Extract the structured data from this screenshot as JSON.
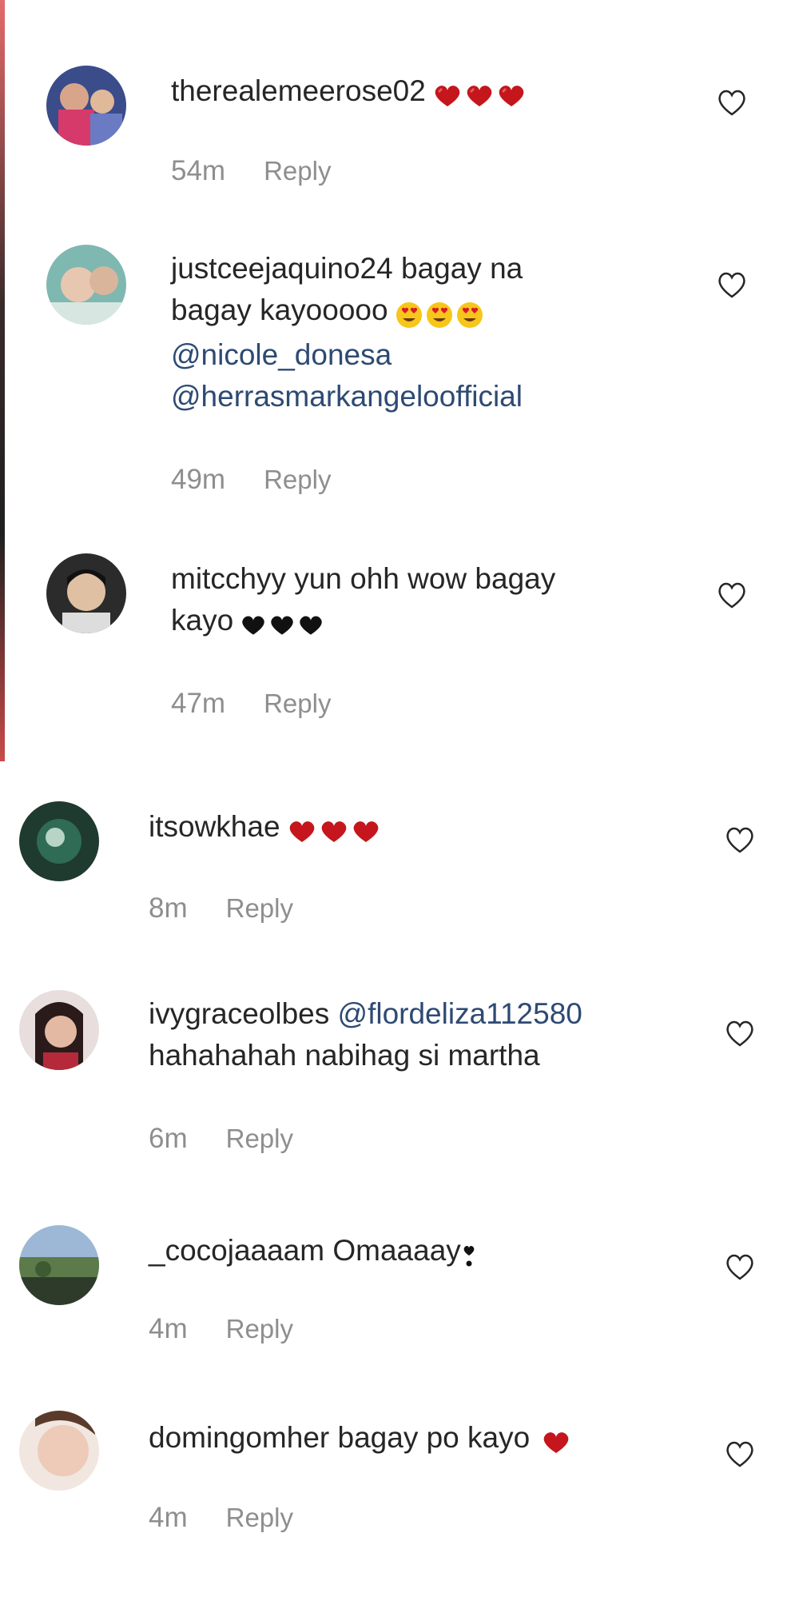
{
  "comments": [
    {
      "username": "therealemeerose02",
      "lines": [
        ""
      ],
      "mentions": [],
      "emoji": {
        "kind": "red-heart-cluster",
        "count": 3
      },
      "time": "54m",
      "reply": "Reply"
    },
    {
      "username": "justceejaquino24",
      "lines": [
        "bagay na",
        "bagay kayooooo"
      ],
      "mentions": [
        "@nicole_donesa",
        "@herrasmarkangeloofficial"
      ],
      "emoji": {
        "kind": "heart-eyes-face",
        "count": 3
      },
      "time": "49m",
      "reply": "Reply"
    },
    {
      "username": "mitcchyy",
      "lines": [
        "yun ohh wow bagay",
        "kayo"
      ],
      "mentions": [],
      "emoji": {
        "kind": "black-heart",
        "count": 3
      },
      "time": "47m",
      "reply": "Reply"
    },
    {
      "username": "itsowkhae",
      "lines": [
        ""
      ],
      "mentions": [],
      "emoji": {
        "kind": "red-heart",
        "count": 3
      },
      "time": "8m",
      "reply": "Reply"
    },
    {
      "username": "ivygraceolbes",
      "lines": [
        "hahahahah nabihag si martha"
      ],
      "mentions": [
        "@flordeliza112580"
      ],
      "emoji": {
        "kind": "none",
        "count": 0
      },
      "time": "6m",
      "reply": "Reply"
    },
    {
      "username": "_cocojaaaam",
      "lines": [
        "Omaaaay"
      ],
      "mentions": [],
      "emoji": {
        "kind": "heart-exclamation",
        "count": 1
      },
      "time": "4m",
      "reply": "Reply"
    },
    {
      "username": "domingomher",
      "lines": [
        "bagay po kayo"
      ],
      "mentions": [],
      "emoji": {
        "kind": "red-heart",
        "count": 1
      },
      "time": "4m",
      "reply": "Reply"
    }
  ],
  "colors": {
    "text": "#262626",
    "meta": "#8e8e8e",
    "mention": "#2d4a73",
    "heart_red": "#c4161c"
  }
}
